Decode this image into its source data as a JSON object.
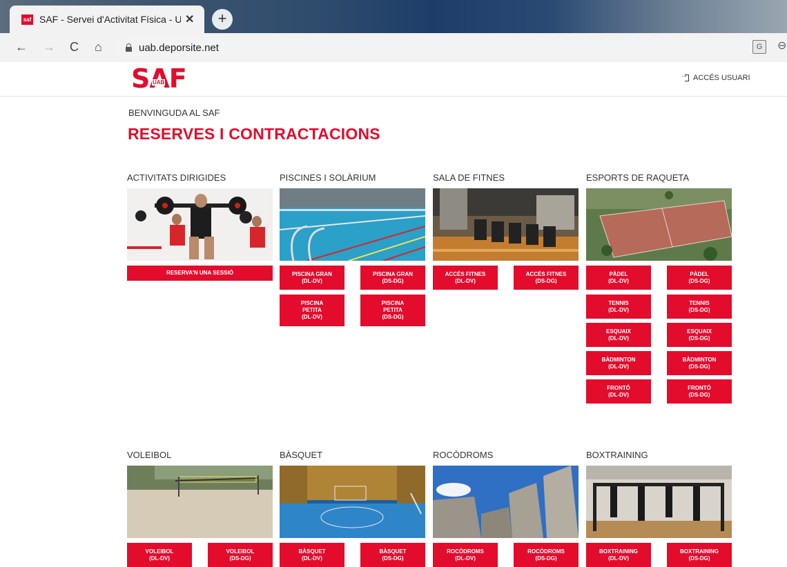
{
  "browser": {
    "tab_title": "SAF - Servei d'Activitat Física - Ur",
    "favicon_text": "saf",
    "close_label": "✕",
    "newtab_label": "+",
    "url": "uab.deporsite.net",
    "back": "←",
    "forward": "→",
    "reload": "C",
    "home": "⌂",
    "translate": "G",
    "more": "⊖"
  },
  "header": {
    "logo_text": "SAF",
    "logo_sub": "UAB",
    "login_label": "ACCÉS USUARI"
  },
  "welcome": "BENVINGUDA AL SAF",
  "page_title": "RESERVES I CONTRACTACIONS",
  "sections": [
    {
      "title": "ACTIVITATS DIRIGIDES",
      "buttons": [
        "RESERVA'N UNA SESSIÓ"
      ]
    },
    {
      "title": "PISCINES I SOLÀRIUM",
      "buttons": [
        "PISCINA GRAN\n(DL-DV)",
        "PISCINA GRAN\n(DS-DG)",
        "PISCINA\nPETITA\n(DL-DV)",
        "PISCINA\nPETITA\n(DS-DG)"
      ]
    },
    {
      "title": "SALA DE FITNES",
      "buttons": [
        "ACCÉS FITNES\n(DL-DV)",
        "ACCÉS FITNES\n(DS-DG)"
      ]
    },
    {
      "title": "ESPORTS DE RAQUETA",
      "buttons": [
        "PÀDEL\n(DL-DV)",
        "PÀDEL\n(DS-DG)",
        "TENNIS\n(DL-DV)",
        "TENNIS\n(DS-DG)",
        "ESQUAIX\n(DL-DV)",
        "ESQUAIX\n(DS-DG)",
        "BÀDMINTON\n(DL-DV)",
        "BÀDMINTON\n(DS-DG)",
        "FRONTÓ\n(DL-DV)",
        "FRONTÓ\n(DS-DG)"
      ]
    },
    {
      "title": "VOLEIBOL",
      "buttons": [
        "VOLEIBOL\n(DL-DV)",
        "VOLEIBOL\n(DS-DG)"
      ]
    },
    {
      "title": "BÀSQUET",
      "buttons": [
        "BÀSQUET\n(DL-DV)",
        "BÀSQUET\n(DS-DG)"
      ]
    },
    {
      "title": "ROCÒDROMS",
      "buttons": [
        "ROCÒDROMS\n(DL-DV)",
        "ROCÒDROMS\n(DS-DG)"
      ]
    },
    {
      "title": "BOXTRAINING",
      "buttons": [
        "BOXTRAINING\n(DL-DV)",
        "BOXTRAINING\n(DS-DG)"
      ]
    }
  ],
  "colors": {
    "brand_red": "#e30c2c"
  }
}
